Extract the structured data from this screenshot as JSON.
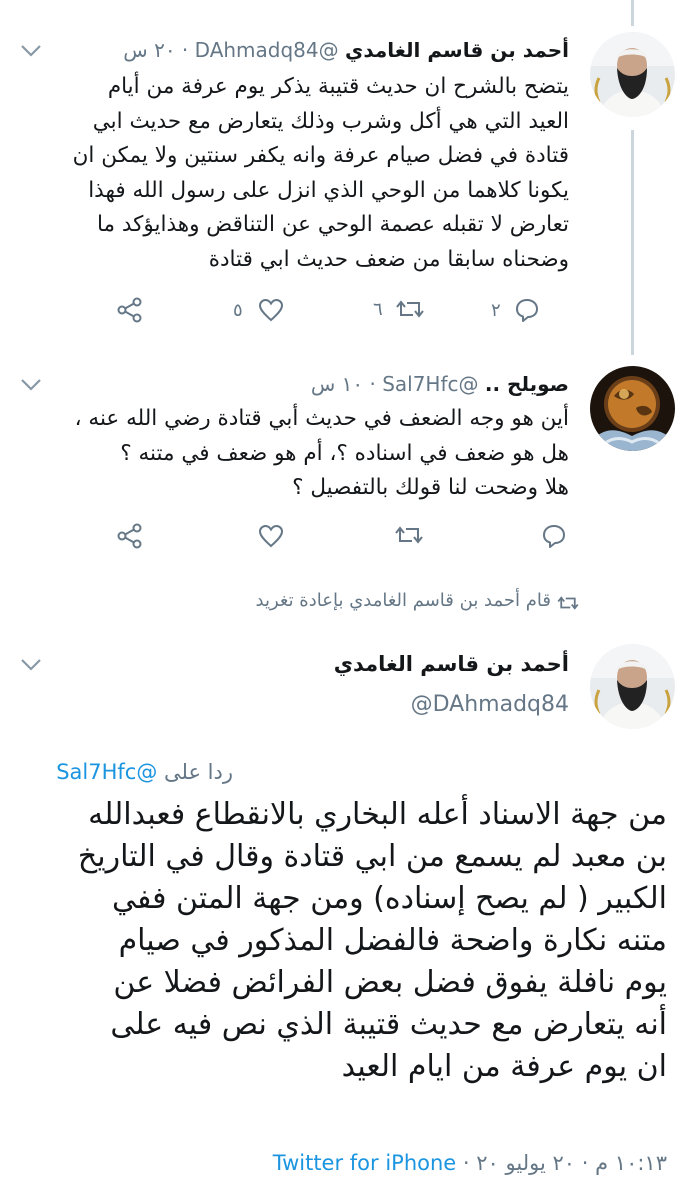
{
  "tweet1": {
    "name": "أحمد بن قاسم الغامدي",
    "handle": "@DAhmadq84",
    "time": "٢٠ س",
    "lines": [
      "يتضح بالشرح ان حديث قتيبة يذكر يوم عرفة من أيام",
      "العيد التي هي أكل وشرب وذلك يتعارض مع حديث ابي",
      "قتادة في فضل صيام عرفة وانه يكفر سنتين ولا يمكن ان",
      "يكونا كلاهما من الوحي الذي انزل على رسول الله فهذا",
      "تعارض لا تقبله عصمة الوحي عن التناقض وهذايؤكد ما",
      "وضحناه سابقا من ضعف حديث ابي قتادة"
    ],
    "replies": "٢",
    "retweets": "٦",
    "likes": "٥"
  },
  "tweet2": {
    "name": "صويلح ..",
    "handle": "@Sal7Hfc",
    "time": "١٠ س",
    "lines": [
      "أين هو وجه الضعف في حديث أبي قتادة رضي الله عنه ،",
      "هل هو ضعف في اسناده ؟، أم هو ضعف في متنه ؟",
      "هلا وضحت لنا قولك بالتفصيل ؟"
    ]
  },
  "retweet_note": "قام أحمد بن قاسم الغامدي بإعادة تغريد",
  "main": {
    "name": "أحمد بن قاسم الغامدي",
    "handle": "@DAhmadq84",
    "reply_prefix": "ردا على",
    "reply_to": "@Sal7Hfc",
    "lines": [
      "من جهة الاسناد أعله البخاري بالانقطاع فعبدالله",
      "بن معبد لم يسمع من ابي قتادة وقال في التاريخ",
      "الكبير ( لم يصح إسناده) ومن جهة المتن ففي",
      "متنه نكارة واضحة فالفضل المذكور في صيام",
      "يوم نافلة يفوق فضل بعض الفرائض فضلا عن",
      "أنه يتعارض مع حديث قتيبة الذي نص فيه على",
      "ان يوم عرفة من ايام العيد"
    ],
    "time": "١٠:١٣ م",
    "date": "٢٠ يوليو ٢٠",
    "source": "Twitter for iPhone"
  },
  "colors": {
    "accent": "#1b95e0",
    "secondary": "#657786",
    "line": "#ccd6dd"
  }
}
